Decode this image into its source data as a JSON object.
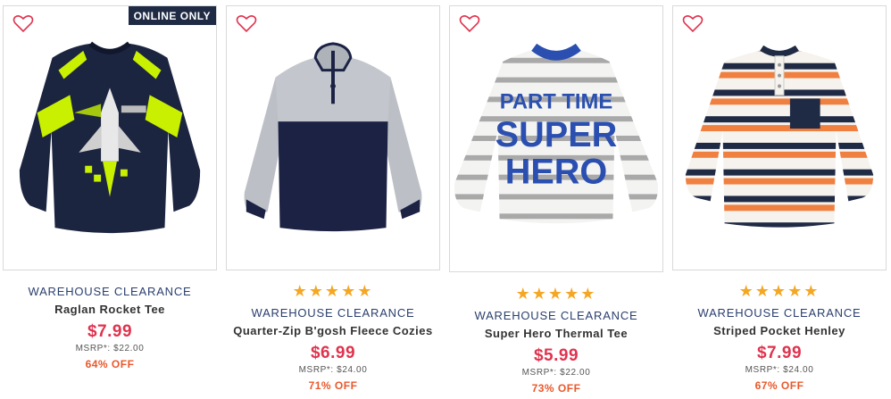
{
  "colors": {
    "brand": "#2a3f6e",
    "price": "#e0334e",
    "discount": "#e9582b",
    "stars": "#f5a623",
    "heart": "#e0334e",
    "badge_bg": "#1f2a44"
  },
  "products": [
    {
      "badge": "ONLINE ONLY",
      "stars": "",
      "brand": "WAREHOUSE CLEARANCE",
      "name": "Raglan Rocket Tee",
      "price": "$7.99",
      "msrp": "MSRP*: $22.00",
      "discount": "64% OFF",
      "icon": "heart-outline-icon"
    },
    {
      "badge": "",
      "stars": "★★★★★",
      "brand": "WAREHOUSE CLEARANCE",
      "name": "Quarter-Zip B'gosh Fleece Cozies",
      "price": "$6.99",
      "msrp": "MSRP*: $24.00",
      "discount": "71% OFF",
      "icon": "heart-outline-icon"
    },
    {
      "badge": "",
      "stars": "★★★★★",
      "brand": "WAREHOUSE CLEARANCE",
      "name": "Super Hero Thermal Tee",
      "price": "$5.99",
      "msrp": "MSRP*: $22.00",
      "discount": "73% OFF",
      "shirt_text": [
        "PART TIME",
        "SUPER",
        "HERO"
      ],
      "icon": "heart-outline-icon"
    },
    {
      "badge": "",
      "stars": "★★★★★",
      "brand": "WAREHOUSE CLEARANCE",
      "name": "Striped Pocket Henley",
      "price": "$7.99",
      "msrp": "MSRP*: $24.00",
      "discount": "67% OFF",
      "icon": "heart-outline-icon"
    }
  ]
}
